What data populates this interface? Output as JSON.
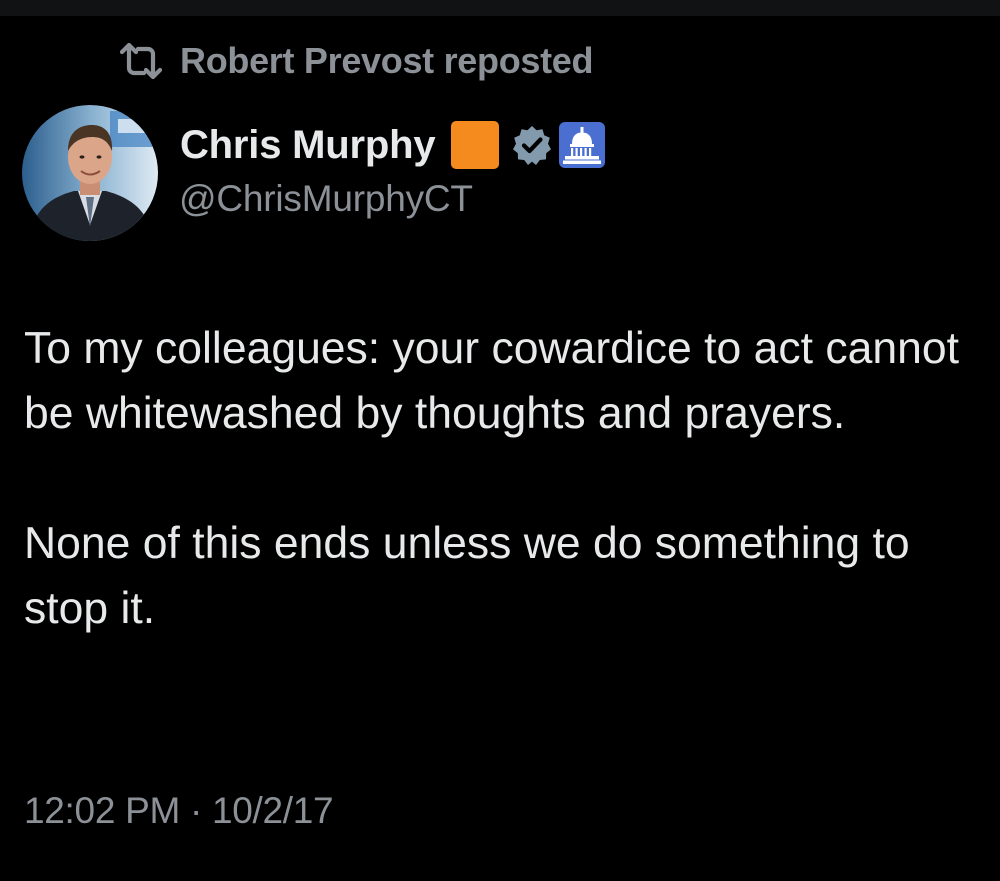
{
  "repost": {
    "icon": "repost-icon",
    "label": "Robert Prevost reposted"
  },
  "author": {
    "avatar_icon": "avatar",
    "display_name": "Chris Murphy",
    "badges": [
      {
        "icon": "orange-square-icon",
        "color": "#f58a1f"
      },
      {
        "icon": "verified-badge-icon",
        "color": "#829aab"
      },
      {
        "icon": "capitol-icon",
        "color": "#4a6fd1"
      }
    ],
    "handle": "@ChrisMurphyCT"
  },
  "tweet": {
    "paragraphs": [
      "To my colleagues: your cowardice to act cannot be whitewashed by thoughts and prayers.",
      "None of this ends unless we do something to stop it."
    ],
    "time": "12:02 PM",
    "separator": "·",
    "date": "10/2/17"
  },
  "colors": {
    "background": "#000000",
    "text_primary": "#e7e9ea",
    "text_secondary": "#8b9197"
  }
}
